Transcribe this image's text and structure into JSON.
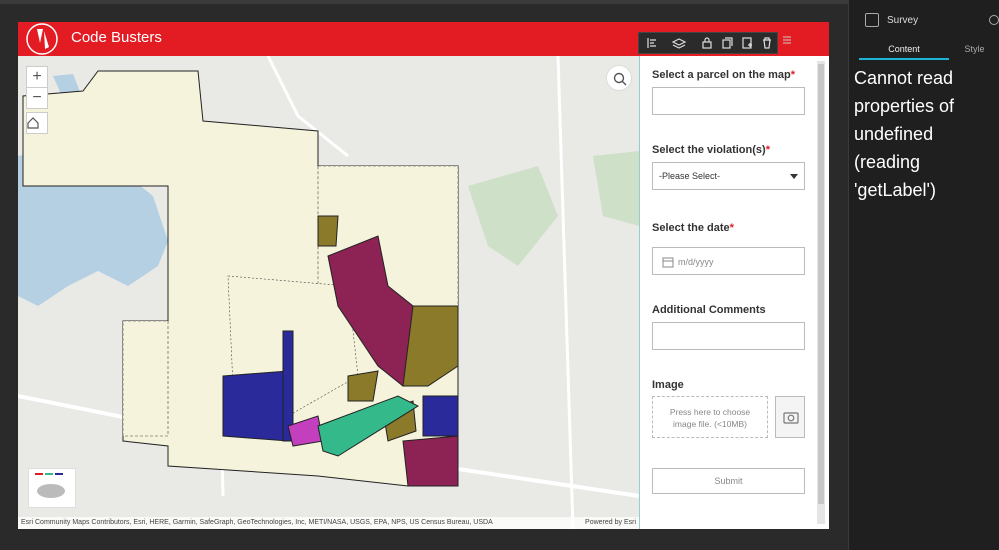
{
  "app": {
    "title": "Code Busters"
  },
  "map": {
    "zoom_in": "+",
    "zoom_out": "−",
    "attribution": "Esri Community Maps Contributors, Esri, HERE, Garmin, SafeGraph, GeoTechnologies, Inc, METI/NASA, USGS, EPA, NPS, US Census Bureau, USDA",
    "powered_by": "Powered by Esri",
    "legend_colors": [
      "#2a2a9a",
      "#c43fbd",
      "#34b98a",
      "#8a7a2a",
      "#8c2354",
      "#f5f3dc"
    ]
  },
  "survey_form": {
    "parcel_label": "Select a parcel on the map",
    "violation_label": "Select the violation(s)",
    "violation_selected": "-Please Select-",
    "date_label": "Select the date",
    "date_placeholder": "m/d/yyyy",
    "comments_label": "Additional Comments",
    "image_label": "Image",
    "upload_text_1": "Press here to choose",
    "upload_text_2": "image file. (<10MB)",
    "submit_label": "Submit",
    "required_mark": "*"
  },
  "settings_panel": {
    "title": "Survey",
    "tabs": [
      {
        "label": "Content",
        "active": true
      },
      {
        "label": "Style",
        "active": false
      }
    ],
    "error_message": "Cannot read properties of undefined (reading 'getLabel')"
  },
  "colors": {
    "header_red": "#e31b23",
    "tab_accent": "#1cb4d6"
  }
}
